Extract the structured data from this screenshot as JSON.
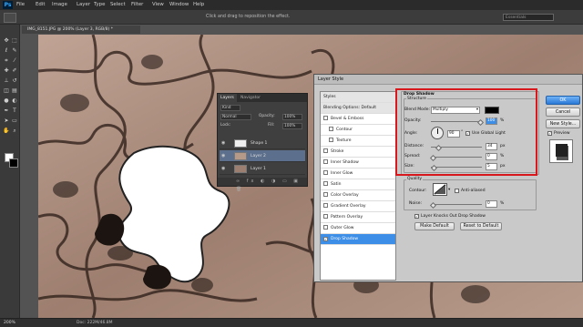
{
  "app": {
    "logo": "Ps",
    "menu": [
      "File",
      "Edit",
      "Image",
      "Layer",
      "Type",
      "Select",
      "Filter",
      "View",
      "Window",
      "Help"
    ],
    "options_hint": "Click and drag to reposition the effect.",
    "workspace": "Essentials"
  },
  "document": {
    "tab_title": "IMG_8151.JPG @ 200% (Layer 3, RGB/8) *"
  },
  "status": {
    "zoom": "200%",
    "doc_size": "Doc: 222M/46.8M"
  },
  "layers_panel": {
    "tabs": [
      "Layers",
      "Navigator"
    ],
    "kind_label": "Kind",
    "blend_mode": "Normal",
    "opacity_label": "Opacity:",
    "opacity": "100%",
    "lock_label": "Lock:",
    "fill_label": "Fill:",
    "fill": "100%",
    "layers": [
      {
        "name": "Shape 1",
        "selected": false
      },
      {
        "name": "Layer 2",
        "selected": true
      },
      {
        "name": "Layer 1",
        "selected": false
      }
    ]
  },
  "layer_style": {
    "title": "Layer Style",
    "styles_header": "Styles",
    "blending_options": "Blending Options: Default",
    "items": [
      {
        "label": "Bevel & Emboss",
        "checked": false,
        "sub": false
      },
      {
        "label": "Contour",
        "checked": false,
        "sub": true
      },
      {
        "label": "Texture",
        "checked": false,
        "sub": true
      },
      {
        "label": "Stroke",
        "checked": false,
        "sub": false
      },
      {
        "label": "Inner Shadow",
        "checked": false,
        "sub": false
      },
      {
        "label": "Inner Glow",
        "checked": false,
        "sub": false
      },
      {
        "label": "Satin",
        "checked": false,
        "sub": false
      },
      {
        "label": "Color Overlay",
        "checked": false,
        "sub": false
      },
      {
        "label": "Gradient Overlay",
        "checked": false,
        "sub": false
      },
      {
        "label": "Pattern Overlay",
        "checked": false,
        "sub": false
      },
      {
        "label": "Outer Glow",
        "checked": false,
        "sub": false
      },
      {
        "label": "Drop Shadow",
        "checked": true,
        "sub": false,
        "selected": true
      }
    ],
    "section_title": "Drop Shadow",
    "structure_label": "Structure",
    "blend_mode_label": "Blend Mode:",
    "blend_mode": "Multiply",
    "shadow_color": "#000000",
    "opacity_label": "Opacity:",
    "opacity": "100",
    "opacity_fraction": 1.0,
    "angle_label": "Angle:",
    "angle": "90",
    "use_global_light": "Use Global Light",
    "distance_label": "Distance:",
    "distance": "34",
    "distance_fraction": 0.12,
    "spread_label": "Spread:",
    "spread": "0",
    "spread_fraction": 0.0,
    "size_label": "Size:",
    "size": "5",
    "size_fraction": 0.02,
    "px": "px",
    "pct": "%",
    "degree": "°",
    "quality_label": "Quality",
    "contour_label": "Contour:",
    "anti_aliased": "Anti-aliased",
    "noise_label": "Noise:",
    "noise": "0",
    "noise_fraction": 0.0,
    "knocks_out": "Layer Knocks Out Drop Shadow",
    "make_default": "Make Default",
    "reset_default": "Reset to Default",
    "ok": "OK",
    "cancel": "Cancel",
    "new_style": "New Style...",
    "preview": "Preview"
  },
  "colors": {
    "accent": "#3d8ee6",
    "highlight_box": "#d7181c"
  }
}
